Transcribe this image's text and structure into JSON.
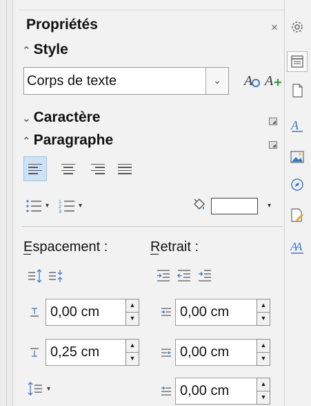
{
  "panel": {
    "title": "Propriétés",
    "close_glyph": "×"
  },
  "style_section": {
    "header": "Style",
    "chevron": "^",
    "combo_value": "Corps de texte",
    "update_style_icon": "A",
    "new_style_icon": "A+"
  },
  "character_section": {
    "header": "Caractère",
    "chevron": "v"
  },
  "paragraph_section": {
    "header": "Paragraphe",
    "chevron": "^",
    "alignment": [
      "left",
      "center",
      "right",
      "justify"
    ],
    "active_alignment": "left",
    "spacing_label": "Espacement :",
    "indent_label": "Retrait :",
    "fields": {
      "above_spacing": "0,00 cm",
      "below_spacing": "0,25 cm",
      "before_indent": "0,00 cm",
      "after_indent": "0,00 cm",
      "first_line_indent": "0,00 cm"
    }
  },
  "tabs": [
    "settings-icon",
    "properties-icon",
    "page-icon",
    "styles-icon",
    "gallery-icon",
    "navigator-icon",
    "manage-changes-icon",
    "style-inspector-icon"
  ],
  "colors": {
    "accent": "#3a7bc8",
    "active_bg": "#cde3f5"
  }
}
